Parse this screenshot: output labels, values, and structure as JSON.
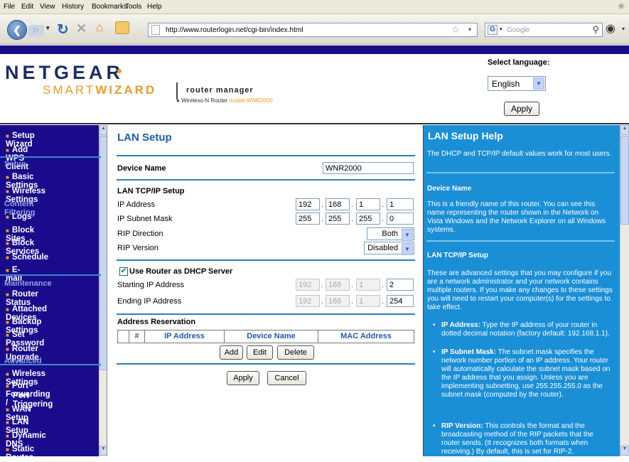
{
  "browser": {
    "menu": [
      "File",
      "Edit",
      "View",
      "History",
      "Bookmarks",
      "Tools",
      "Help"
    ],
    "url": "http://www.routerlogin.net/cgi-bin/index.html",
    "search_placeholder": "Google"
  },
  "header": {
    "logo": "NETGEAR",
    "smart": "SMART",
    "wizard": "WIZARD",
    "router_manager": "router manager",
    "model_prefix": "Wireless-N Router",
    "model_label": "model WNR2000",
    "select_language_label": "Select language:",
    "language_value": "English",
    "apply_label": "Apply"
  },
  "sidebar": {
    "items": [
      {
        "label": "Setup Wizard",
        "kind": "item"
      },
      {
        "label": "Add WPS Client",
        "kind": "item"
      },
      {
        "label": "Setup",
        "kind": "cat"
      },
      {
        "label": "Basic Settings",
        "kind": "item"
      },
      {
        "label": "Wireless Settings",
        "kind": "item"
      },
      {
        "label": "Content Filtering",
        "kind": "cat"
      },
      {
        "label": "Logs",
        "kind": "item"
      },
      {
        "label": "Block Sites",
        "kind": "item"
      },
      {
        "label": "Block Services",
        "kind": "item"
      },
      {
        "label": "Schedule",
        "kind": "item"
      },
      {
        "label": "E-mail",
        "kind": "item"
      },
      {
        "label": "Maintenance",
        "kind": "cat"
      },
      {
        "label": "Router Status",
        "kind": "item"
      },
      {
        "label": "Attached Devices",
        "kind": "item"
      },
      {
        "label": "Backup Settings",
        "kind": "item"
      },
      {
        "label": "Set Password",
        "kind": "item"
      },
      {
        "label": "Router Upgrade",
        "kind": "item"
      },
      {
        "label": "Advanced",
        "kind": "cat"
      },
      {
        "label": "Wireless Settings",
        "kind": "item"
      },
      {
        "label": "Port Forwarding /",
        "kind": "item"
      },
      {
        "label": "Port Triggering",
        "kind": "cont"
      },
      {
        "label": "WAN Setup",
        "kind": "item"
      },
      {
        "label": "LAN Setup",
        "kind": "item"
      },
      {
        "label": "Dynamic DNS",
        "kind": "item"
      },
      {
        "label": "Static Routes",
        "kind": "item"
      }
    ]
  },
  "main": {
    "title": "LAN Setup",
    "device_name_label": "Device Name",
    "device_name_value": "WNR2000",
    "lan_tcpip_label": "LAN TCP/IP Setup",
    "ip_address_label": "IP Address",
    "ip_address": [
      "192",
      "168",
      "1",
      "1"
    ],
    "subnet_label": "IP Subnet Mask",
    "subnet": [
      "255",
      "255",
      "255",
      "0"
    ],
    "rip_direction_label": "RIP Direction",
    "rip_direction_value": "Both",
    "rip_version_label": "RIP Version",
    "rip_version_value": "Disabled",
    "dhcp_label": "Use Router as DHCP Server",
    "start_ip_label": "Starting IP Address",
    "start_ip": [
      "192",
      "168",
      "1",
      "2"
    ],
    "end_ip_label": "Ending IP Address",
    "end_ip": [
      "192",
      "168",
      "1",
      "254"
    ],
    "address_reservation_label": "Address Reservation",
    "table_headers": [
      "#",
      "IP Address",
      "Device Name",
      "MAC Address"
    ],
    "add_label": "Add",
    "edit_label": "Edit",
    "delete_label": "Delete",
    "apply_label": "Apply",
    "cancel_label": "Cancel"
  },
  "help": {
    "title": "LAN Setup Help",
    "intro": "The DHCP and TCP/IP default values work for most users.",
    "device_name_heading": "Device Name",
    "device_name_text": "This is a friendly name of this router. You can see this name representing the router shown in the Network on Vista Windows and the Network Explorer on all Windows systems.",
    "lan_heading": "LAN TCP/IP Setup",
    "lan_text": "These are advanced settings that you may configure if you are a network administrator and your network contains multiple routers. If you make any changes to these settings you will need to restart your computer(s) for the settings to take effect.",
    "b1_label": "IP Address:",
    "b1_text": " Type the IP address of your router in dotted decimal notation (factory default: 192.168.1.1).",
    "b2_label": "IP Subnet Mask:",
    "b2_text": " The subnet mask specifies the network number portion of an IP address. Your router will automatically calculate the subnet mask based on the IP address that you assign. Unless you are implementing subnetting, use 255.255.255.0 as the subnet mask (computed by the router).",
    "b3_label": "RIP Version:",
    "b3_text": " This controls the format and the broadcasting method of the RIP packets that the router sends. (It recognizes both formats when receiving.) By default, this is set for RIP-2."
  }
}
